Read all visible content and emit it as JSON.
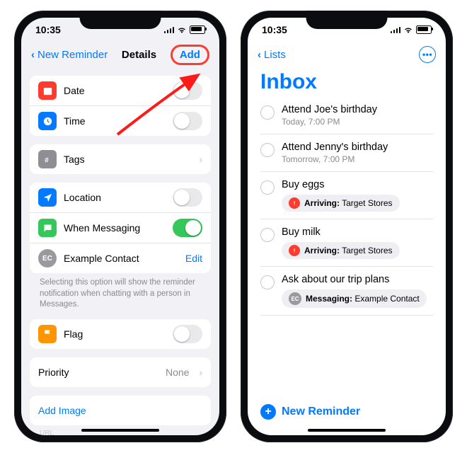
{
  "left": {
    "status_time": "10:35",
    "nav_back": "New Reminder",
    "nav_title": "Details",
    "nav_add": "Add",
    "rows": {
      "date": "Date",
      "time": "Time",
      "tags": "Tags",
      "location": "Location",
      "messaging": "When Messaging",
      "contact_initials": "EC",
      "contact": "Example  Contact",
      "edit": "Edit",
      "messaging_hint": "Selecting this option will show the reminder notification when chatting with a person in Messages.",
      "flag": "Flag",
      "priority": "Priority",
      "priority_value": "None",
      "add_image": "Add Image",
      "url_label": "URL"
    }
  },
  "right": {
    "status_time": "10:35",
    "nav_back": "Lists",
    "title": "Inbox",
    "items": [
      {
        "title": "Attend Joe's birthday",
        "subtitle": "Today, 7:00 PM"
      },
      {
        "title": "Attend Jenny's birthday",
        "subtitle": "Tomorrow, 7:00 PM"
      },
      {
        "title": "Buy eggs",
        "pill_kind": "arriving",
        "pill_strong": "Arriving:",
        "pill_text": " Target Stores"
      },
      {
        "title": "Buy milk",
        "pill_kind": "arriving",
        "pill_strong": "Arriving:",
        "pill_text": " Target Stores"
      },
      {
        "title": "Ask about our trip plans",
        "pill_kind": "messaging",
        "pill_ec": "EC",
        "pill_strong": "Messaging:",
        "pill_text": " Example  Contact"
      }
    ],
    "new_reminder": "New Reminder"
  }
}
